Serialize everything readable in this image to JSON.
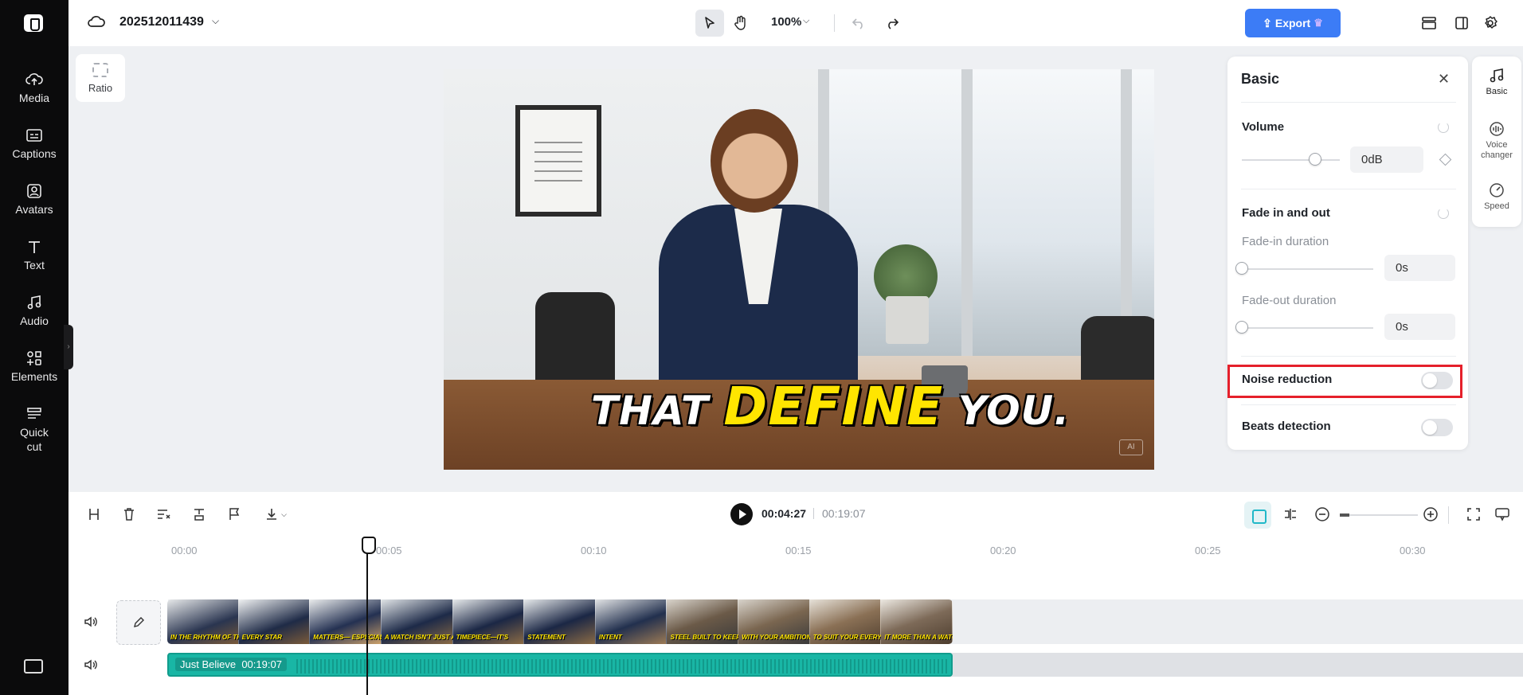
{
  "rail": {
    "items": [
      {
        "label": "Media",
        "icon": "cloud-upload-icon"
      },
      {
        "label": "Captions",
        "icon": "captions-icon"
      },
      {
        "label": "Avatars",
        "icon": "avatar-icon"
      },
      {
        "label": "Text",
        "icon": "text-icon"
      },
      {
        "label": "Audio",
        "icon": "music-note-icon"
      },
      {
        "label": "Elements",
        "icon": "elements-icon"
      },
      {
        "label": "Quick",
        "label2": "cut",
        "icon": "quick-cut-icon"
      }
    ]
  },
  "topbar": {
    "project_name": "202512011439",
    "zoom": "100%",
    "export_label": "Export"
  },
  "canvas": {
    "ratio_label": "Ratio",
    "caption_pre": "THAT",
    "caption_highlight": "DEFINE",
    "caption_post": "YOU.",
    "watermark": "AI"
  },
  "panel": {
    "title": "Basic",
    "volume_label": "Volume",
    "volume_value": "0dB",
    "volume_level": 0.75,
    "fade_label": "Fade in and out",
    "fade_in_label": "Fade-in duration",
    "fade_in_value": "0s",
    "fade_out_label": "Fade-out duration",
    "fade_out_value": "0s",
    "noise_label": "Noise reduction",
    "noise_on": false,
    "beats_label": "Beats detection",
    "beats_on": false,
    "highlight_color": "#e5202b"
  },
  "side_tabs": [
    {
      "label": "Basic"
    },
    {
      "label": "Voice changer"
    },
    {
      "label": "Speed"
    }
  ],
  "timeline": {
    "current_time": "00:04:27",
    "total_time": "00:19:07",
    "ruler": [
      "00:00",
      "00:05",
      "00:10",
      "00:15",
      "00:20",
      "00:25",
      "00:30"
    ],
    "thumb_captions": [
      "IN THE RHYTHM OF THE",
      "EVERY STAR",
      "MATTERS— ESPECIALLY THE ONES",
      "A WATCH ISN'T JUST A",
      "TIMEPIECE—IT'S",
      "STATEMENT",
      "INTENT",
      "STEEL BUILT TO KEEP UP",
      "WITH YOUR AMBITION",
      "TO SUIT YOUR EVERYDAY",
      "IT MORE THAN A WATCH—IT'S"
    ],
    "audio_name": "Just Believe",
    "audio_duration": "00:19:07",
    "accent": "#19b6a5"
  }
}
